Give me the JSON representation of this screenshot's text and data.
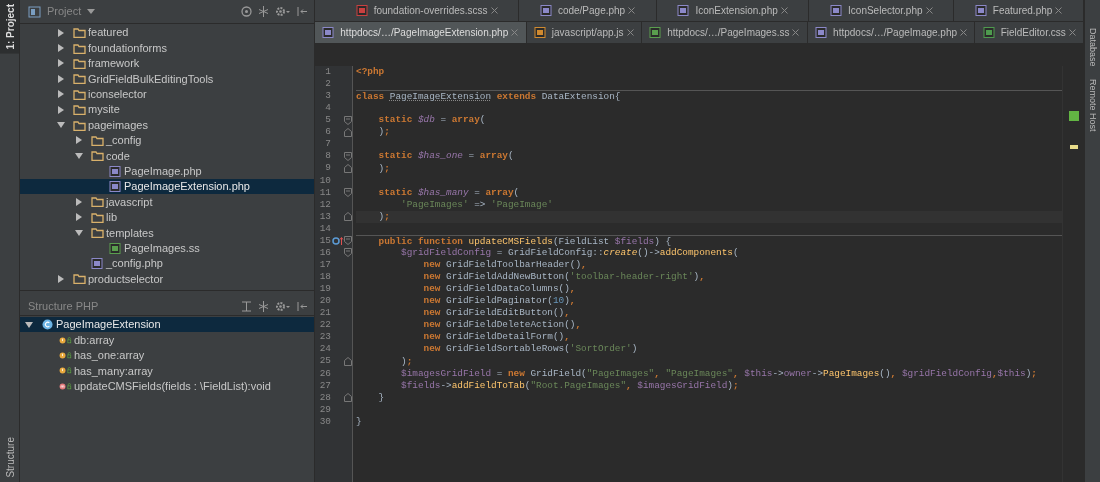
{
  "left_stripe": {
    "top_tab": "1: Project",
    "bottom_tab": "Structure"
  },
  "project_panel": {
    "title": "Project",
    "tree": [
      {
        "label": "featured",
        "kind": "folder",
        "expanded": false,
        "selected": false
      },
      {
        "label": "foundationforms",
        "kind": "folder",
        "expanded": false,
        "selected": false
      },
      {
        "label": "framework",
        "kind": "folder",
        "expanded": false,
        "selected": false
      },
      {
        "label": "GridFieldBulkEditingTools",
        "kind": "folder",
        "expanded": false,
        "selected": false
      },
      {
        "label": "iconselector",
        "kind": "folder",
        "expanded": false,
        "selected": false
      },
      {
        "label": "mysite",
        "kind": "folder",
        "expanded": false,
        "selected": false
      },
      {
        "label": "pageimages",
        "kind": "folder",
        "expanded": true,
        "selected": false,
        "children": [
          {
            "label": "_config",
            "kind": "folder",
            "expanded": false,
            "selected": false
          },
          {
            "label": "code",
            "kind": "folder",
            "expanded": true,
            "selected": false,
            "children": [
              {
                "label": "PageImage.php",
                "kind": "php",
                "selected": false
              },
              {
                "label": "PageImageExtension.php",
                "kind": "php",
                "selected": true
              }
            ]
          },
          {
            "label": "javascript",
            "kind": "folder",
            "expanded": false,
            "selected": false
          },
          {
            "label": "lib",
            "kind": "folder",
            "expanded": false,
            "selected": false
          },
          {
            "label": "templates",
            "kind": "folder",
            "expanded": true,
            "selected": false,
            "children": [
              {
                "label": "PageImages.ss",
                "kind": "ss",
                "selected": false
              }
            ]
          },
          {
            "label": "_config.php",
            "kind": "php",
            "selected": false
          }
        ]
      },
      {
        "label": "productselector",
        "kind": "folder",
        "expanded": false,
        "selected": false
      }
    ]
  },
  "structure_panel": {
    "title": "Structure PHP",
    "tree": [
      {
        "label": "PageImageExtension",
        "kind": "class",
        "expanded": true,
        "selected": true,
        "children": [
          {
            "label": "db:array",
            "kind": "field",
            "selected": false
          },
          {
            "label": "has_one:array",
            "kind": "field",
            "selected": false
          },
          {
            "label": "has_many:array",
            "kind": "field",
            "selected": false
          },
          {
            "label": "updateCMSFields(fields : \\FieldList):void",
            "kind": "method",
            "selected": false
          }
        ]
      }
    ]
  },
  "tab_rows": [
    [
      {
        "label": "foundation-overrides.scss",
        "kind": "scss",
        "selected": false
      },
      {
        "label": "code/Page.php",
        "kind": "php",
        "selected": false
      },
      {
        "label": "IconExtension.php",
        "kind": "php",
        "selected": false
      },
      {
        "label": "IconSelector.php",
        "kind": "php",
        "selected": false
      },
      {
        "label": "Featured.php",
        "kind": "php",
        "selected": false
      }
    ],
    [
      {
        "label": "httpdocs/…/PageImageExtension.php",
        "kind": "php",
        "selected": true
      },
      {
        "label": "javascript/app.js",
        "kind": "js",
        "selected": false
      },
      {
        "label": "httpdocs/…/PageImages.ss",
        "kind": "ss",
        "selected": false
      },
      {
        "label": "httpdocs/…/PageImage.php",
        "kind": "php",
        "selected": false
      },
      {
        "label": "FieldEditor.css",
        "kind": "css",
        "selected": false
      }
    ]
  ],
  "editor": {
    "lines": [
      {
        "number": "1",
        "fold_start": false,
        "fold_end": false,
        "tokens": [
          {
            "kind": "keyword",
            "text": "<?php"
          }
        ]
      },
      {
        "number": "2",
        "fold_start": false,
        "fold_end": false
      },
      {
        "number": "3",
        "fold_start": false,
        "fold_end": false,
        "separator": true,
        "tokens": [
          {
            "kind": "keyword",
            "text": "class "
          },
          {
            "kind": "warning",
            "text": "PageImageExtension"
          },
          {
            "kind": "keyword",
            "text": " extends"
          },
          {
            "kind": "plain",
            "text": " DataExtension{"
          }
        ]
      },
      {
        "number": "4",
        "fold_start": false,
        "fold_end": false
      },
      {
        "number": "5",
        "fold_start": true,
        "fold_end": false,
        "tokens": [
          {
            "kind": "keyword",
            "text": "    static"
          },
          {
            "kind": "field",
            "text": " $db"
          },
          {
            "kind": "plain",
            "text": " = "
          },
          {
            "kind": "keyword",
            "text": "array"
          },
          {
            "kind": "plain",
            "text": "("
          }
        ]
      },
      {
        "number": "6",
        "fold_start": false,
        "fold_end": true,
        "tokens": [
          {
            "kind": "plain",
            "text": "    )"
          },
          {
            "kind": "keyword",
            "text": ";"
          }
        ]
      },
      {
        "number": "7",
        "fold_start": false,
        "fold_end": false
      },
      {
        "number": "8",
        "fold_start": true,
        "fold_end": false,
        "tokens": [
          {
            "kind": "keyword",
            "text": "    static"
          },
          {
            "kind": "field",
            "text": " $has_one"
          },
          {
            "kind": "plain",
            "text": " = "
          },
          {
            "kind": "keyword",
            "text": "array"
          },
          {
            "kind": "plain",
            "text": "("
          }
        ]
      },
      {
        "number": "9",
        "fold_start": false,
        "fold_end": true,
        "tokens": [
          {
            "kind": "plain",
            "text": "    )"
          },
          {
            "kind": "keyword",
            "text": ";"
          }
        ]
      },
      {
        "number": "10",
        "fold_start": false,
        "fold_end": false
      },
      {
        "number": "11",
        "fold_start": true,
        "fold_end": false,
        "tokens": [
          {
            "kind": "keyword",
            "text": "    static"
          },
          {
            "kind": "field",
            "text": " $has_many"
          },
          {
            "kind": "plain",
            "text": " = "
          },
          {
            "kind": "keyword",
            "text": "array"
          },
          {
            "kind": "plain",
            "text": "("
          }
        ]
      },
      {
        "number": "12",
        "fold_start": false,
        "fold_end": false,
        "tokens": [
          {
            "kind": "string",
            "text": "        'PageImages'"
          },
          {
            "kind": "plain",
            "text": " => "
          },
          {
            "kind": "string",
            "text": "'PageImage'"
          }
        ]
      },
      {
        "number": "13",
        "fold_start": false,
        "fold_end": true,
        "current": true,
        "tokens": [
          {
            "kind": "plain",
            "text": "    )"
          },
          {
            "kind": "keyword",
            "text": ";"
          }
        ]
      },
      {
        "number": "14",
        "fold_start": false,
        "fold_end": false
      },
      {
        "number": "15",
        "fold_start": true,
        "fold_end": false,
        "separator": true,
        "override": true,
        "tokens": [
          {
            "kind": "keyword",
            "text": "    public function"
          },
          {
            "kind": "function",
            "text": " updateCMSFields"
          },
          {
            "kind": "plain",
            "text": "(FieldList "
          },
          {
            "kind": "variable",
            "text": "$fields"
          },
          {
            "kind": "plain",
            "text": ") {"
          }
        ]
      },
      {
        "number": "16",
        "fold_start": true,
        "fold_end": false,
        "tokens": [
          {
            "kind": "variable",
            "text": "        $gridFieldConfig"
          },
          {
            "kind": "plain",
            "text": " = GridFieldConfig::"
          },
          {
            "kind": "static",
            "text": "create"
          },
          {
            "kind": "plain",
            "text": "()->"
          },
          {
            "kind": "function",
            "text": "addComponents"
          },
          {
            "kind": "plain",
            "text": "("
          }
        ]
      },
      {
        "number": "17",
        "fold_start": false,
        "fold_end": false,
        "tokens": [
          {
            "kind": "keyword",
            "text": "            new"
          },
          {
            "kind": "plain",
            "text": " GridFieldToolbarHeader()"
          },
          {
            "kind": "keyword",
            "text": ","
          }
        ]
      },
      {
        "number": "18",
        "fold_start": false,
        "fold_end": false,
        "tokens": [
          {
            "kind": "keyword",
            "text": "            new"
          },
          {
            "kind": "plain",
            "text": " GridFieldAddNewButton("
          },
          {
            "kind": "string",
            "text": "'toolbar-header-right'"
          },
          {
            "kind": "plain",
            "text": ")"
          },
          {
            "kind": "keyword",
            "text": ","
          }
        ]
      },
      {
        "number": "19",
        "fold_start": false,
        "fold_end": false,
        "tokens": [
          {
            "kind": "keyword",
            "text": "            new"
          },
          {
            "kind": "plain",
            "text": " GridFieldDataColumns()"
          },
          {
            "kind": "keyword",
            "text": ","
          }
        ]
      },
      {
        "number": "20",
        "fold_start": false,
        "fold_end": false,
        "tokens": [
          {
            "kind": "keyword",
            "text": "            new"
          },
          {
            "kind": "plain",
            "text": " GridFieldPaginator("
          },
          {
            "kind": "number",
            "text": "10"
          },
          {
            "kind": "plain",
            "text": ")"
          },
          {
            "kind": "keyword",
            "text": ","
          }
        ]
      },
      {
        "number": "21",
        "fold_start": false,
        "fold_end": false,
        "tokens": [
          {
            "kind": "keyword",
            "text": "            new"
          },
          {
            "kind": "plain",
            "text": " GridFieldEditButton()"
          },
          {
            "kind": "keyword",
            "text": ","
          }
        ]
      },
      {
        "number": "22",
        "fold_start": false,
        "fold_end": false,
        "tokens": [
          {
            "kind": "keyword",
            "text": "            new"
          },
          {
            "kind": "plain",
            "text": " GridFieldDeleteAction()"
          },
          {
            "kind": "keyword",
            "text": ","
          }
        ]
      },
      {
        "number": "23",
        "fold_start": false,
        "fold_end": false,
        "tokens": [
          {
            "kind": "keyword",
            "text": "            new"
          },
          {
            "kind": "plain",
            "text": " GridFieldDetailForm()"
          },
          {
            "kind": "keyword",
            "text": ","
          }
        ]
      },
      {
        "number": "24",
        "fold_start": false,
        "fold_end": false,
        "tokens": [
          {
            "kind": "keyword",
            "text": "            new"
          },
          {
            "kind": "plain",
            "text": " GridFieldSortableRows("
          },
          {
            "kind": "string",
            "text": "'SortOrder'"
          },
          {
            "kind": "plain",
            "text": ")"
          }
        ]
      },
      {
        "number": "25",
        "fold_start": false,
        "fold_end": true,
        "tokens": [
          {
            "kind": "plain",
            "text": "        )"
          },
          {
            "kind": "keyword",
            "text": ";"
          }
        ]
      },
      {
        "number": "26",
        "fold_start": false,
        "fold_end": false,
        "tokens": [
          {
            "kind": "variable",
            "text": "        $imagesGridField"
          },
          {
            "kind": "plain",
            "text": " = "
          },
          {
            "kind": "keyword",
            "text": "new"
          },
          {
            "kind": "plain",
            "text": " GridField("
          },
          {
            "kind": "string",
            "text": "\"PageImages\""
          },
          {
            "kind": "keyword",
            "text": ", "
          },
          {
            "kind": "string",
            "text": "\"PageImages\""
          },
          {
            "kind": "keyword",
            "text": ", "
          },
          {
            "kind": "variable",
            "text": "$this"
          },
          {
            "kind": "plain",
            "text": "->"
          },
          {
            "kind": "variable",
            "text": "owner"
          },
          {
            "kind": "plain",
            "text": "->"
          },
          {
            "kind": "function",
            "text": "PageImages"
          },
          {
            "kind": "plain",
            "text": "()"
          },
          {
            "kind": "keyword",
            "text": ", "
          },
          {
            "kind": "variable",
            "text": "$gridFieldConfig"
          },
          {
            "kind": "keyword",
            "text": ","
          },
          {
            "kind": "variable",
            "text": "$this"
          },
          {
            "kind": "plain",
            "text": ")"
          },
          {
            "kind": "keyword",
            "text": ";"
          }
        ]
      },
      {
        "number": "27",
        "fold_start": false,
        "fold_end": false,
        "tokens": [
          {
            "kind": "variable",
            "text": "        $fields"
          },
          {
            "kind": "plain",
            "text": "->"
          },
          {
            "kind": "function",
            "text": "addFieldToTab"
          },
          {
            "kind": "plain",
            "text": "("
          },
          {
            "kind": "string",
            "text": "\"Root.PageImages\""
          },
          {
            "kind": "keyword",
            "text": ", "
          },
          {
            "kind": "variable",
            "text": "$imagesGridField"
          },
          {
            "kind": "plain",
            "text": ")"
          },
          {
            "kind": "keyword",
            "text": ";"
          }
        ]
      },
      {
        "number": "28",
        "fold_start": false,
        "fold_end": true,
        "tokens": [
          {
            "kind": "plain",
            "text": "    }"
          }
        ]
      },
      {
        "number": "29",
        "fold_start": false,
        "fold_end": false
      },
      {
        "number": "30",
        "fold_start": false,
        "fold_end": false,
        "tokens": [
          {
            "kind": "plain",
            "text": "}"
          }
        ]
      }
    ]
  },
  "right_stripe": {
    "tabs": [
      "Database",
      "Remote Host"
    ]
  }
}
